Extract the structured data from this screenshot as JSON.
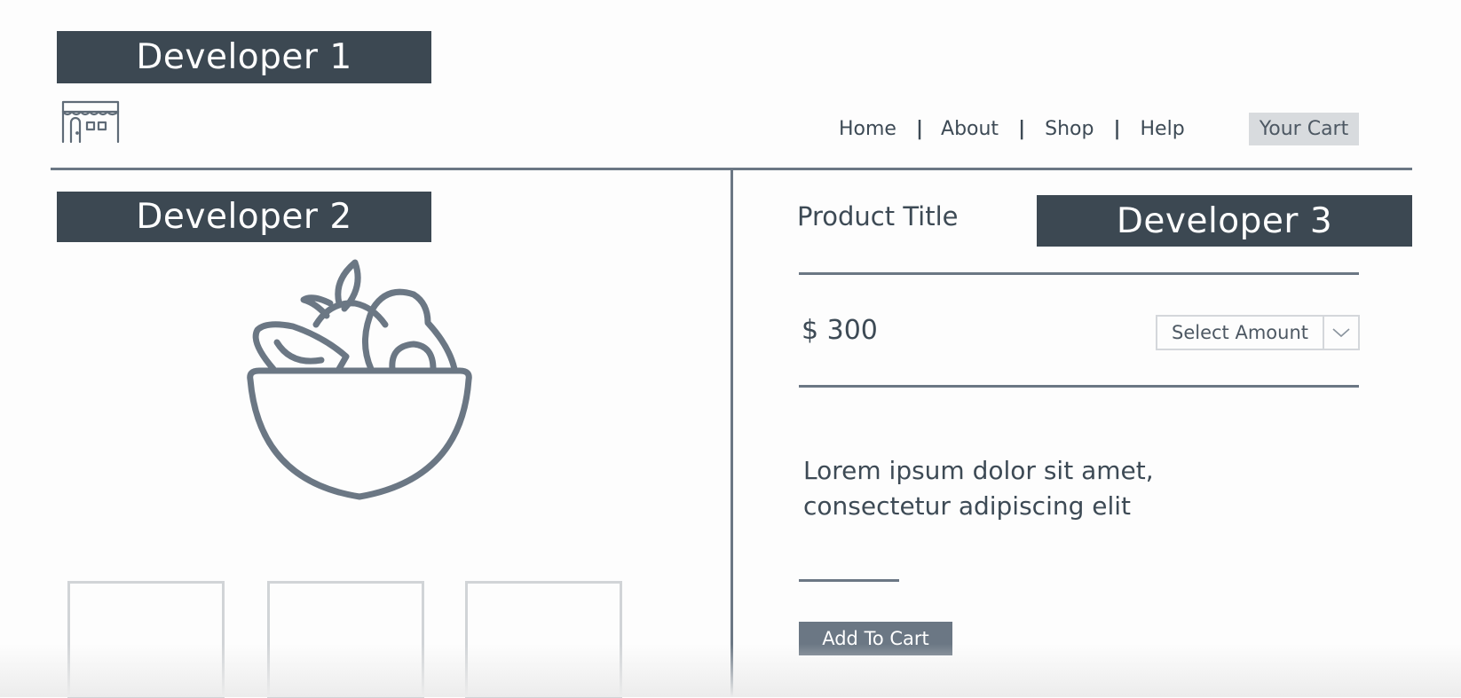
{
  "labels": {
    "developer1": "Developer 1",
    "developer2": "Developer 2",
    "developer3": "Developer 3"
  },
  "header": {
    "logo_icon": "storefront-icon",
    "nav": {
      "home": "Home",
      "about": "About",
      "shop": "Shop",
      "help": "Help",
      "separator": "|"
    },
    "cart_label": "Your Cart"
  },
  "product": {
    "image_icon": "fruit-bowl-icon",
    "title": "Product Title",
    "price": "$ 300",
    "amount_select": {
      "placeholder": "Select Amount",
      "arrow_icon": "chevron-down-icon"
    },
    "description_line1": "Lorem ipsum dolor sit amet,",
    "description_line2": "consectetur adipiscing elit",
    "add_to_cart_label": "Add To Cart"
  },
  "colors": {
    "dark_label_bg": "#3c4852",
    "line": "#6b7784",
    "text": "#3d4a55",
    "cart_bg": "#d8dbde",
    "button_bg": "#6b7784"
  }
}
